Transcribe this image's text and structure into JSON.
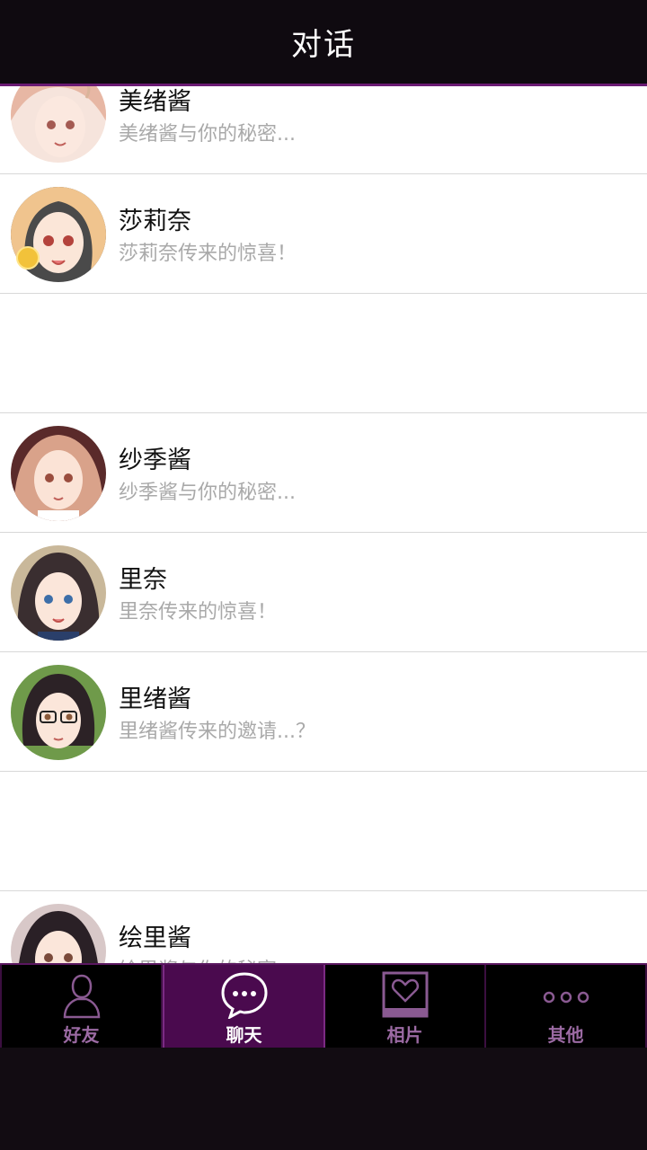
{
  "header": {
    "title": "对话"
  },
  "conversations": [
    {
      "name": "美绪酱",
      "preview": "美绪酱与你的秘密...",
      "avatar": "avatar-mio"
    },
    {
      "name": "莎莉奈",
      "preview": "莎莉奈传来的惊喜！",
      "avatar": "avatar-sarina"
    },
    {
      "name": "",
      "preview": "",
      "avatar": ""
    },
    {
      "name": "纱季酱",
      "preview": "纱季酱与你的秘密...",
      "avatar": "avatar-saki"
    },
    {
      "name": "里奈",
      "preview": "里奈传来的惊喜！",
      "avatar": "avatar-rina"
    },
    {
      "name": "里绪酱",
      "preview": "里绪酱传来的邀请...？",
      "avatar": "avatar-rio"
    },
    {
      "name": "",
      "preview": "",
      "avatar": ""
    },
    {
      "name": "绘里酱",
      "preview": "绘里酱与你的秘密...",
      "avatar": "avatar-eri"
    }
  ],
  "tabs": [
    {
      "label": "好友",
      "icon": "person-icon",
      "active": false
    },
    {
      "label": "聊天",
      "icon": "chat-bubble-icon",
      "active": true
    },
    {
      "label": "相片",
      "icon": "photo-heart-icon",
      "active": false
    },
    {
      "label": "其他",
      "icon": "more-dots-icon",
      "active": false
    }
  ],
  "colors": {
    "header_bg": "#0f0a10",
    "accent": "#6a1a73",
    "active_tab_bg": "#4a0a4e",
    "tab_label": "#9b6aa3",
    "preview_text": "#a9a9a9"
  }
}
